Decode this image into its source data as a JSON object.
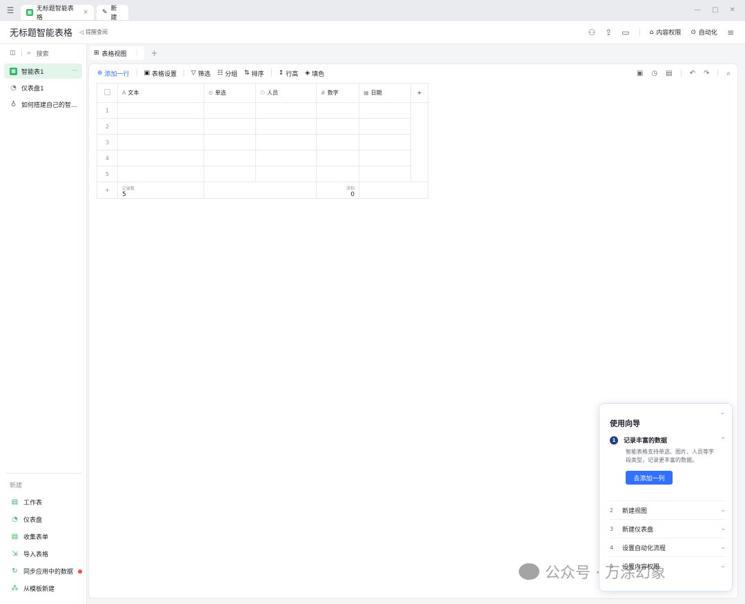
{
  "tabbar": {
    "active_tab": "无标题智能表格",
    "new_tab": "新建"
  },
  "header": {
    "title": "无标题智能表格",
    "remind": "提醒查阅",
    "permission": "内容权限",
    "automation": "自动化"
  },
  "sidebar": {
    "search": "搜索",
    "items": [
      {
        "label": "智能表1",
        "icon": "table-icon"
      },
      {
        "label": "仪表盘1",
        "icon": "dashboard-icon"
      },
      {
        "label": "如何搭建自己的智...",
        "icon": "bulb-icon"
      }
    ],
    "new_label": "新建",
    "new_items": [
      {
        "label": "工作表",
        "icon": "sheet-icon"
      },
      {
        "label": "仪表盘",
        "icon": "dashboard-icon"
      },
      {
        "label": "收集表单",
        "icon": "form-icon"
      },
      {
        "label": "导入表格",
        "icon": "import-icon"
      },
      {
        "label": "同步应用中的数据",
        "icon": "sync-icon"
      },
      {
        "label": "从模板新建",
        "icon": "template-icon"
      }
    ]
  },
  "view": {
    "tab_label": "表格视图"
  },
  "toolbar": {
    "add_row": "添加一行",
    "table_settings": "表格设置",
    "filter": "筛选",
    "group": "分组",
    "sort": "排序",
    "row_height": "行高",
    "fill": "填色"
  },
  "grid": {
    "columns": [
      "文本",
      "单选",
      "人员",
      "数字",
      "日期"
    ],
    "rows": [
      "1",
      "2",
      "3",
      "4",
      "5"
    ],
    "summary": {
      "count_caption": "记录数",
      "count_value": "5",
      "sum_caption": "求和",
      "sum_value": "0"
    }
  },
  "guide": {
    "title": "使用向导",
    "step1_num": "1",
    "step1_title": "记录丰富的数据",
    "step1_desc": "智能表格支持单选、图片、人员等字段类型，记录更丰富的数据。",
    "step1_button": "去添加一列",
    "steps": [
      {
        "num": "2",
        "label": "新建视图"
      },
      {
        "num": "3",
        "label": "新建仪表盘"
      },
      {
        "num": "4",
        "label": "设置自动化流程"
      },
      {
        "num": "5",
        "label": "设置内容权限"
      }
    ]
  },
  "watermark": "公众号 · 万涂幻象"
}
